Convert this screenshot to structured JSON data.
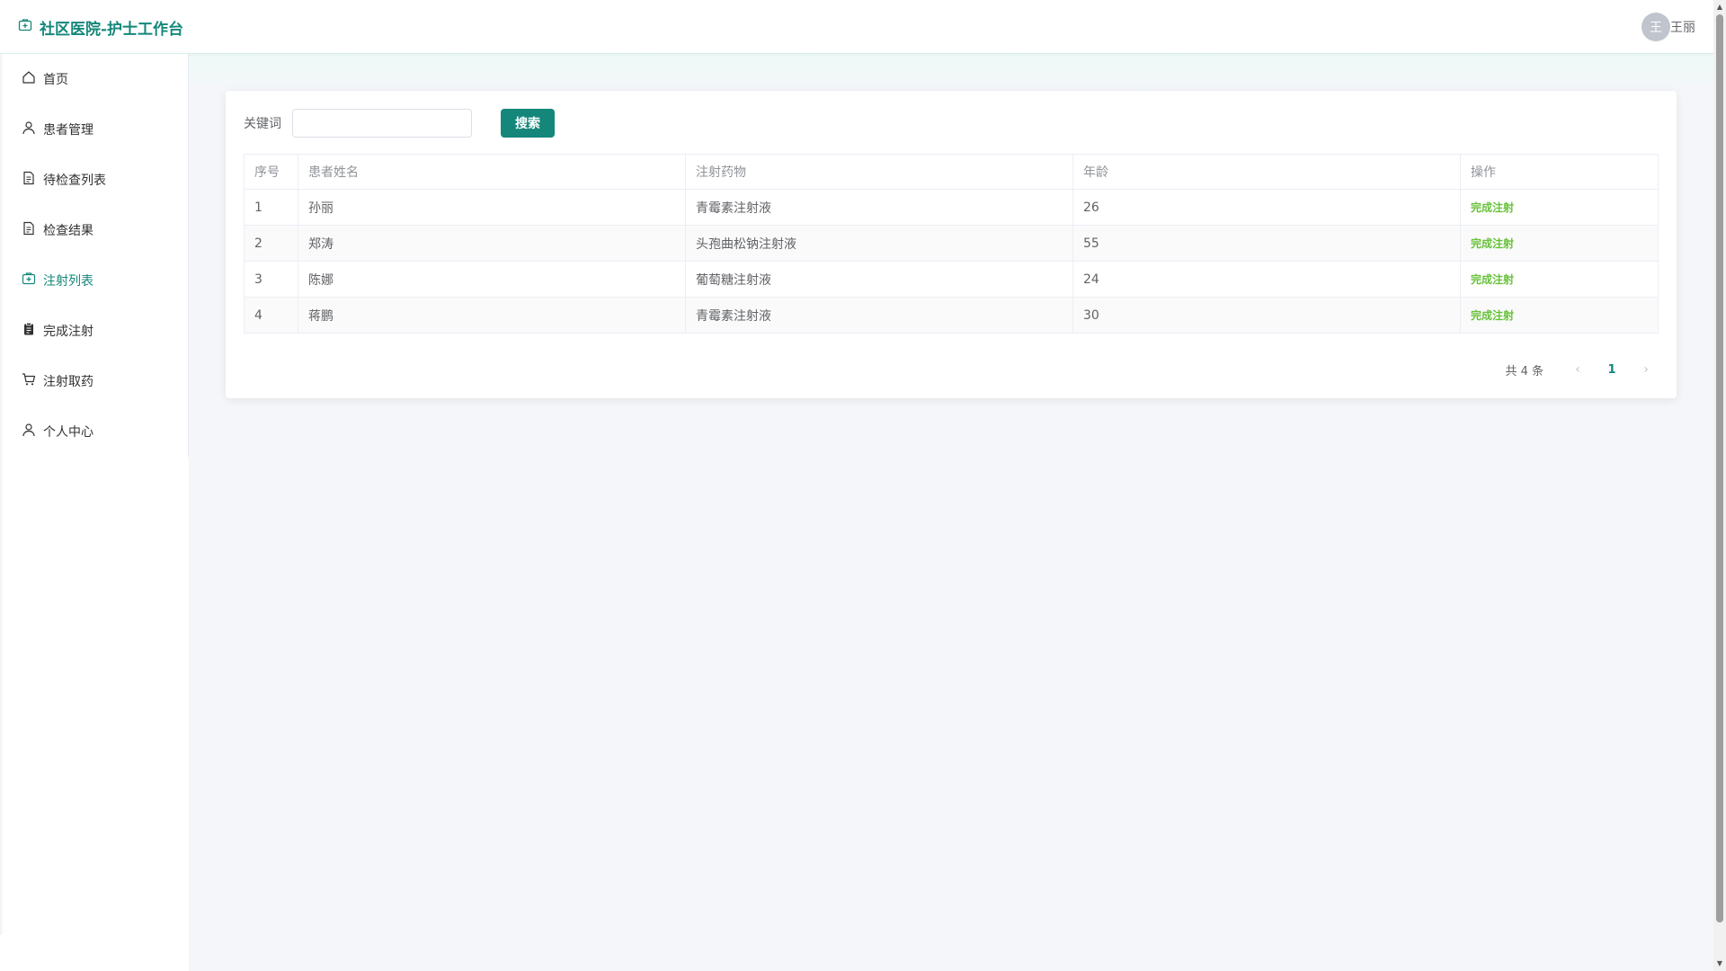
{
  "header": {
    "brand": "社区医院-护士工作台",
    "user": {
      "avatar_initial": "王",
      "name": "王丽"
    }
  },
  "sidebar": {
    "items": [
      {
        "label": "首页",
        "icon": "home-icon",
        "active": false
      },
      {
        "label": "患者管理",
        "icon": "user-icon",
        "active": false
      },
      {
        "label": "待检查列表",
        "icon": "document-icon",
        "active": false
      },
      {
        "label": "检查结果",
        "icon": "document-icon",
        "active": false
      },
      {
        "label": "注射列表",
        "icon": "first-aid-icon",
        "active": true
      },
      {
        "label": "完成注射",
        "icon": "clipboard-icon",
        "active": false
      },
      {
        "label": "注射取药",
        "icon": "cart-icon",
        "active": false
      },
      {
        "label": "个人中心",
        "icon": "user-icon",
        "active": false
      }
    ]
  },
  "search": {
    "label": "关键词",
    "value": "",
    "placeholder": "",
    "button": "搜索"
  },
  "table": {
    "headers": [
      "序号",
      "患者姓名",
      "注射药物",
      "年龄",
      "操作"
    ],
    "rows": [
      {
        "idx": "1",
        "name": "孙丽",
        "drug": "青霉素注射液",
        "age": "26",
        "action": "完成注射"
      },
      {
        "idx": "2",
        "name": "郑涛",
        "drug": "头孢曲松钠注射液",
        "age": "55",
        "action": "完成注射"
      },
      {
        "idx": "3",
        "name": "陈娜",
        "drug": "葡萄糖注射液",
        "age": "24",
        "action": "完成注射"
      },
      {
        "idx": "4",
        "name": "蒋鹏",
        "drug": "青霉素注射液",
        "age": "30",
        "action": "完成注射"
      }
    ]
  },
  "pagination": {
    "total": "共 4 条",
    "current_page": "1",
    "prev": "‹",
    "next": "›"
  },
  "colors": {
    "accent": "#14877a",
    "action": "#67c23a"
  }
}
